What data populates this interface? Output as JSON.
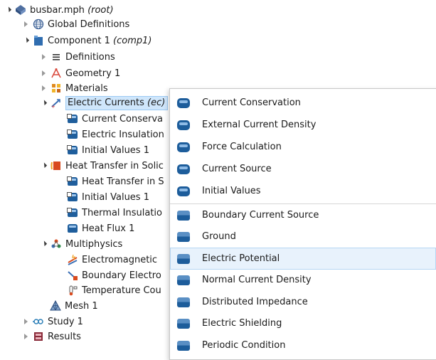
{
  "tree": {
    "root": {
      "label": "busbar.mph",
      "suffix": "(root)"
    },
    "global_definitions": "Global Definitions",
    "component": {
      "label": "Component 1",
      "suffix": "(comp1)"
    },
    "definitions": "Definitions",
    "geometry": "Geometry 1",
    "materials": "Materials",
    "electric_currents": {
      "label": "Electric Currents",
      "suffix": "(ec)"
    },
    "ec_children": [
      "Current Conserva",
      "Electric Insulation",
      "Initial Values 1"
    ],
    "heat_transfer": "Heat Transfer in Solic",
    "ht_children": [
      "Heat Transfer in S",
      "Initial Values 1",
      "Thermal Insulatio",
      "Heat Flux 1"
    ],
    "multiphysics": "Multiphysics",
    "mp_children": [
      "Electromagnetic",
      "Boundary Electro",
      "Temperature Cou"
    ],
    "mesh": "Mesh 1",
    "study": "Study 1",
    "results": "Results"
  },
  "menu": {
    "domain_items": [
      "Current Conservation",
      "External Current Density",
      "Force Calculation",
      "Current Source",
      "Initial Values"
    ],
    "boundary_items": [
      "Boundary Current Source",
      "Ground",
      "Electric Potential",
      "Normal Current Density",
      "Distributed Impedance",
      "Electric Shielding",
      "Periodic Condition"
    ],
    "highlighted": "Electric Potential"
  },
  "colors": {
    "selection": "#cfe6fb",
    "menu_hover": "#e8f2fc",
    "feature_icon": "#1d5d9b"
  }
}
